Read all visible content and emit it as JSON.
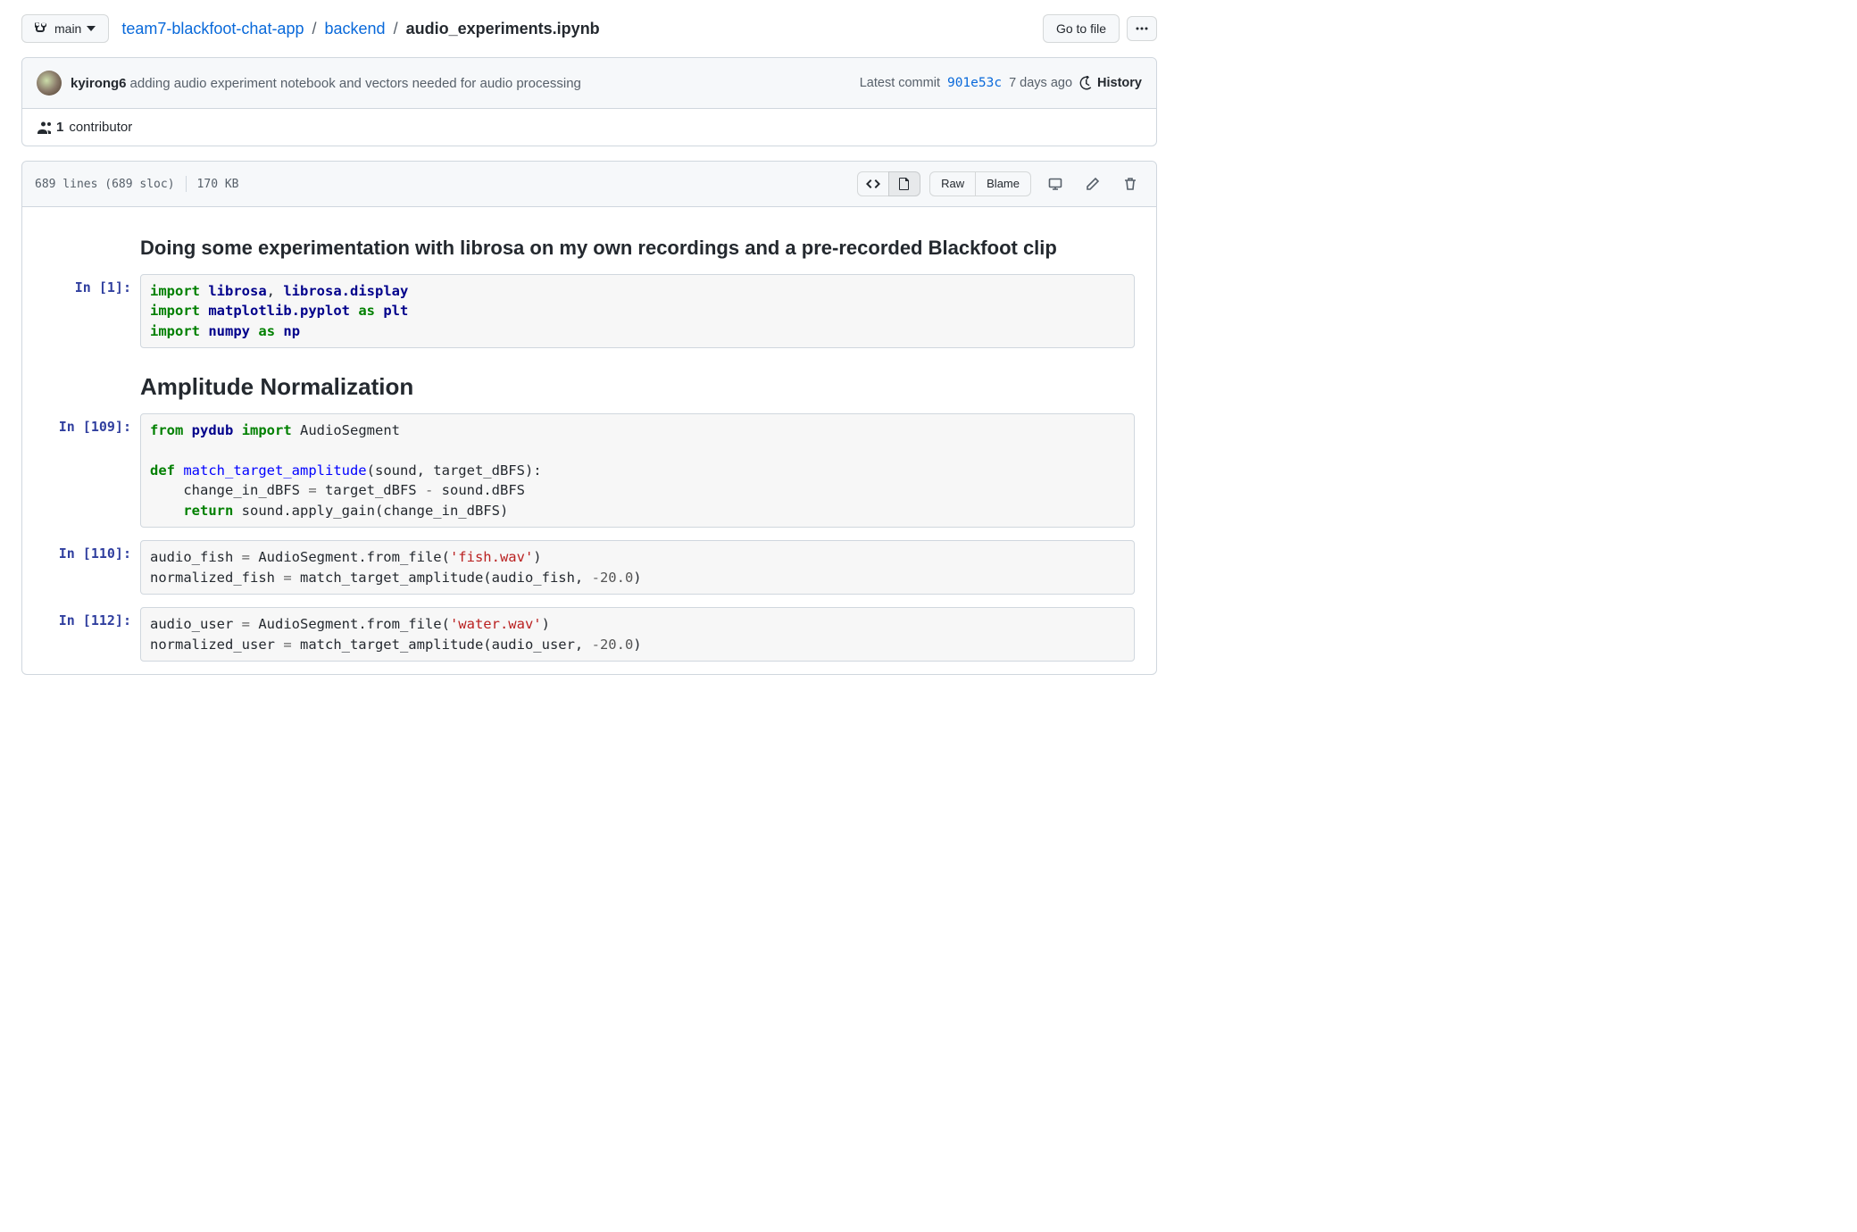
{
  "branch": "main",
  "breadcrumb": {
    "repo": "team7-blackfoot-chat-app",
    "dir": "backend",
    "file": "audio_experiments.ipynb"
  },
  "buttons": {
    "go_to_file": "Go to file",
    "raw": "Raw",
    "blame": "Blame"
  },
  "commit": {
    "author": "kyirong6",
    "message": "adding audio experiment notebook and vectors needed for audio processing",
    "prefix": "Latest commit",
    "sha": "901e53c",
    "when": "7 days ago",
    "history_label": "History"
  },
  "contributors": {
    "count": "1",
    "label": "contributor"
  },
  "file_info": {
    "lines": "689 lines (689 sloc)",
    "size": "170 KB"
  },
  "notebook": {
    "h3": "Doing some experimentation with librosa on my own recordings and a pre-recorded Blackfoot clip",
    "h2": "Amplitude Normalization",
    "cells": [
      {
        "prompt": "In [1]:"
      },
      {
        "prompt": "In [109]:"
      },
      {
        "prompt": "In [110]:"
      },
      {
        "prompt": "In [112]:"
      }
    ]
  }
}
